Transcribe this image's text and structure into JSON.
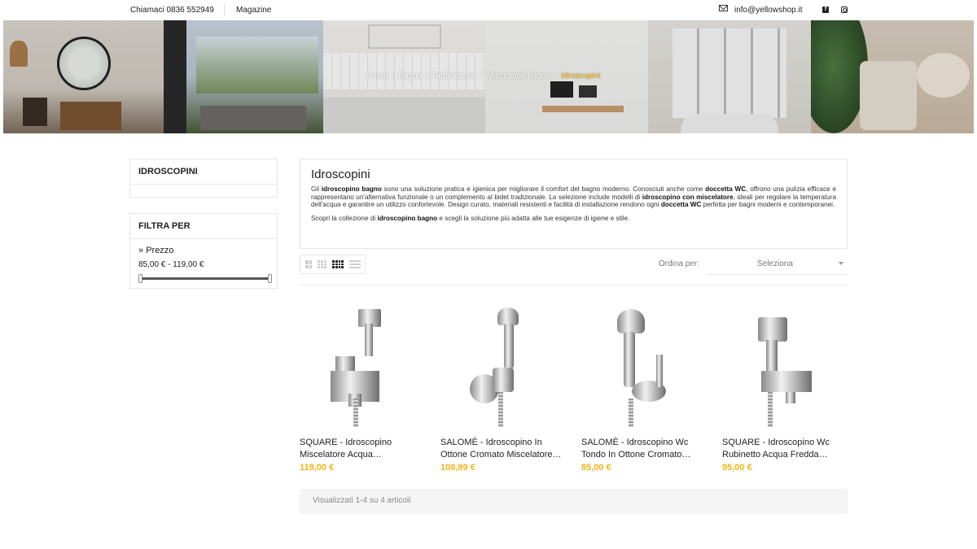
{
  "topbar": {
    "phone": "Chiamaci 0836 552949",
    "magazine": "Magazine",
    "email": "info@yellowshop.it",
    "icons": [
      "mail-icon",
      "facebook-icon",
      "instagram-icon"
    ]
  },
  "breadcrumb": {
    "items": [
      "Home",
      "Bagno",
      "Rubinetteria",
      "Miscelatori bagno"
    ],
    "current": "Idroscopini"
  },
  "sidebar": {
    "category_title": "IDROSCOPINI",
    "filter_title": "FILTRA PER",
    "price_label": "Prezzo",
    "price_range": "85,00 € - 119,00 €",
    "price_min": 85,
    "price_max": 119
  },
  "description": {
    "title": "Idroscopini",
    "p1_a": "Gli ",
    "p1_b": "idroscopino bagno",
    "p1_c": " sono una soluzione pratica e igienica per migliorare il comfort del bagno moderno. Conosciuti anche come ",
    "p1_d": "doccetta WC",
    "p1_e": ", offrono una pulizia efficace e rappresentano un'alternativa funzionale o un complemento al bidet tradizionale. La selezione include modelli di ",
    "p1_f": "idroscopino con miscelatore",
    "p1_g": ", ideali per regolare la temperatura dell'acqua e garantire un utilizzo confortevole. Design curato, materiali resistenti e facilità di installazione rendono ogni ",
    "p1_h": "doccetta WC",
    "p1_i": " perfetta per bagni moderni e contemporanei.",
    "p2_a": "Scopri la collezione di ",
    "p2_b": "idroscopino bagno",
    "p2_c": " e scegli la soluzione più adatta alle tue esigenze di igiene e stile."
  },
  "toolbar": {
    "sort_label": "Ordina per:",
    "sort_value": "Seleziona",
    "view_icons": [
      "grid-2-icon",
      "grid-3-icon",
      "grid-4-icon",
      "list-icon"
    ],
    "active_view": "grid-4-icon"
  },
  "products": [
    {
      "name": "SQUARE - Idroscopino Miscelatore Acqua…",
      "price": "119,00 €"
    },
    {
      "name": "SALOMÈ - Idroscopino In Ottone Cromato Miscelatore…",
      "price": "108,99 €"
    },
    {
      "name": "SALOMÈ - Idroscopino Wc Tondo In Ottone Cromato…",
      "price": "85,00 €"
    },
    {
      "name": "SQUARE - Idroscopino Wc Rubinetto Acqua Fredda…",
      "price": "95,00 €"
    }
  ],
  "pagination": {
    "summary": "Visualizzati 1-4 su 4 articoli"
  },
  "colors": {
    "accent": "#f3b415",
    "text": "#222222",
    "border": "#e6e6e6"
  }
}
